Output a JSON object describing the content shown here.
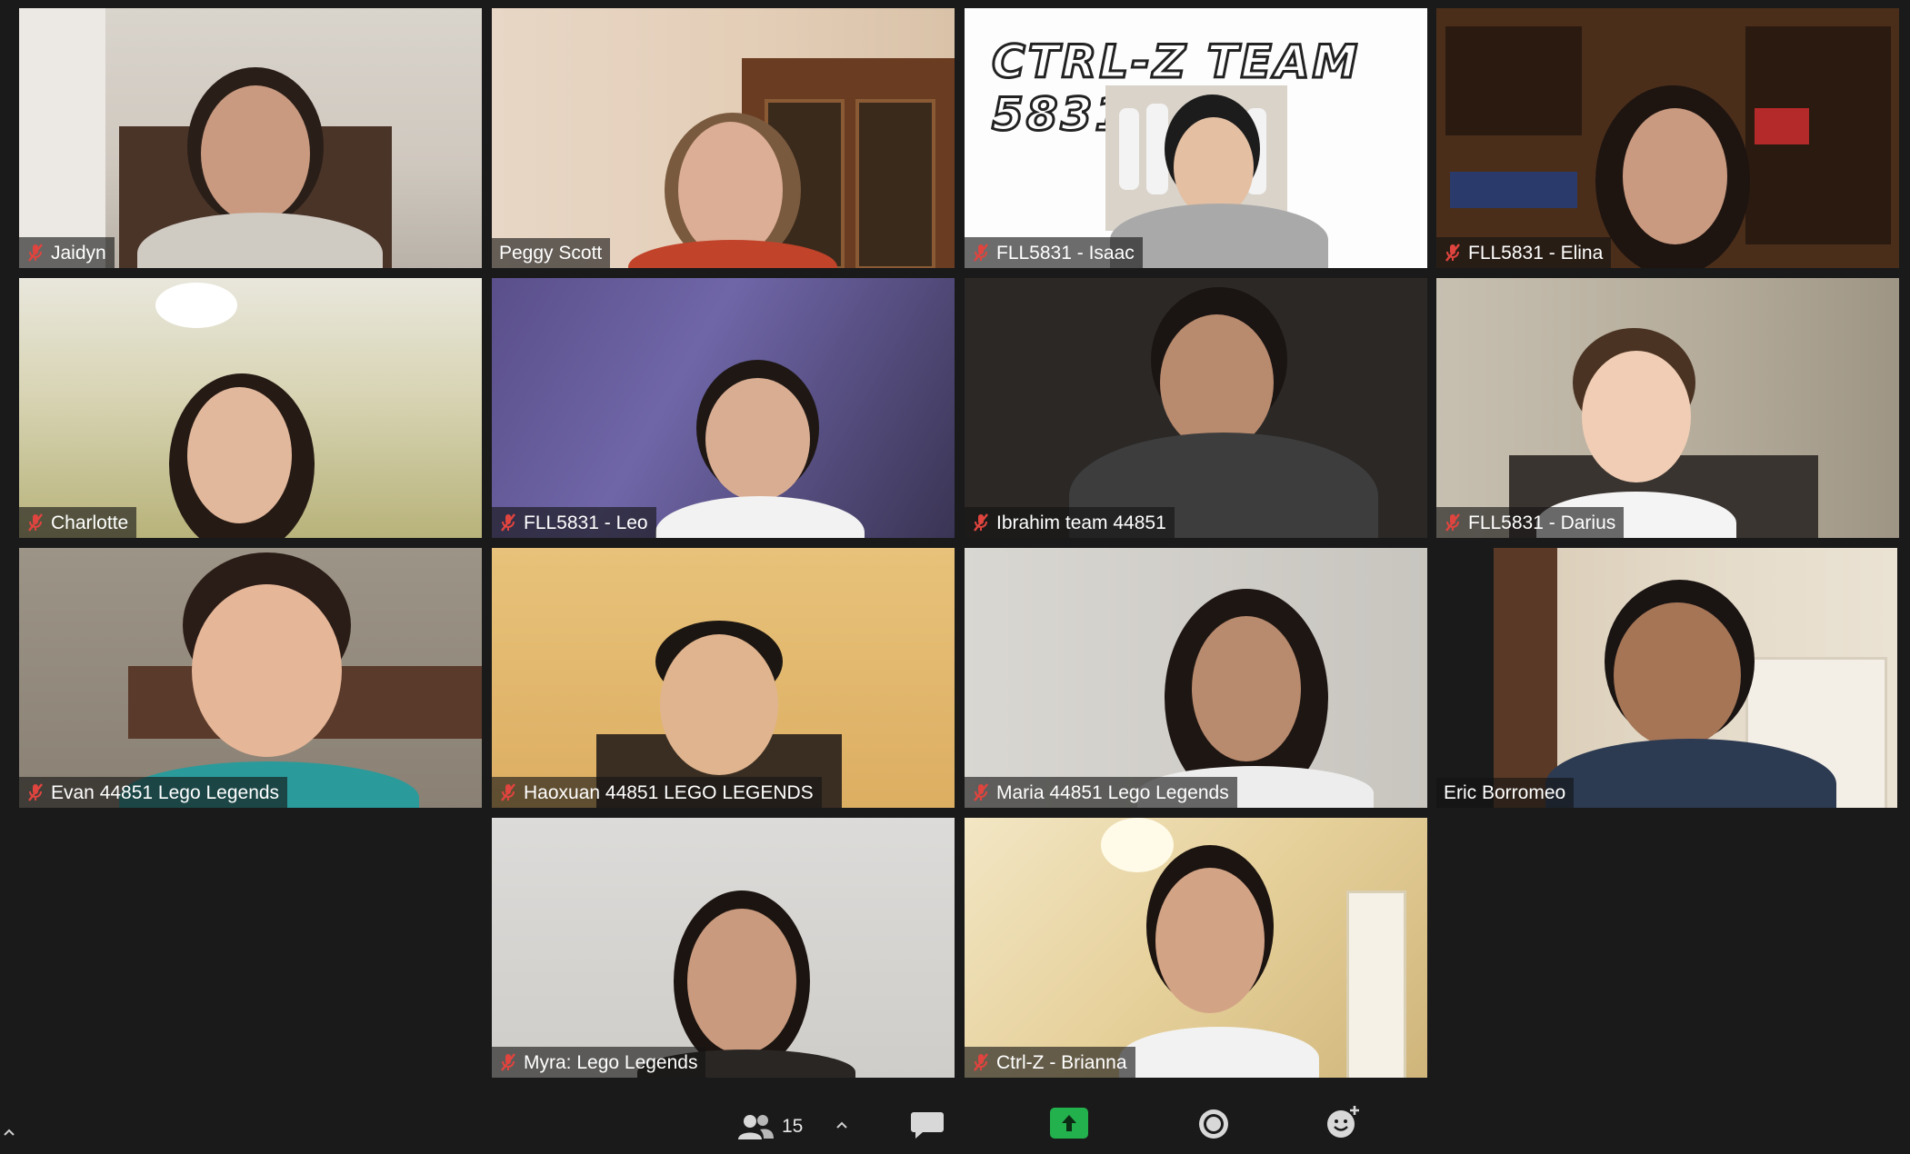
{
  "participants": [
    {
      "name": "Jaidyn",
      "muted": true
    },
    {
      "name": "Peggy Scott",
      "muted": false,
      "active_speaker": true
    },
    {
      "name": "FLL5831 - Isaac",
      "muted": true,
      "banner_text": "CTRL-Z TEAM 5831"
    },
    {
      "name": "FLL5831 - Elina",
      "muted": true
    },
    {
      "name": "Charlotte",
      "muted": true
    },
    {
      "name": "FLL5831 - Leo",
      "muted": true
    },
    {
      "name": "Ibrahim team 44851",
      "muted": true
    },
    {
      "name": "FLL5831 - Darius",
      "muted": true
    },
    {
      "name": "Evan 44851 Lego Legends",
      "muted": true
    },
    {
      "name": "Haoxuan 44851 LEGO LEGENDS",
      "muted": true
    },
    {
      "name": "Maria 44851 Lego Legends",
      "muted": true
    },
    {
      "name": "Eric Borromeo",
      "muted": false
    },
    {
      "name": "Myra: Lego Legends",
      "muted": true
    },
    {
      "name": "Ctrl-Z - Brianna",
      "muted": true
    }
  ],
  "toolbar": {
    "participants_count": "15",
    "icons": [
      "chevron-up-icon",
      "participants-icon",
      "chevron-up-icon",
      "chat-icon",
      "share-screen-icon",
      "record-icon",
      "reactions-icon"
    ]
  },
  "colors": {
    "active_speaker_border": "#c6e05a",
    "muted_icon": "#e0443e",
    "share_green": "#22b14c",
    "background": "#1a1a1a"
  }
}
